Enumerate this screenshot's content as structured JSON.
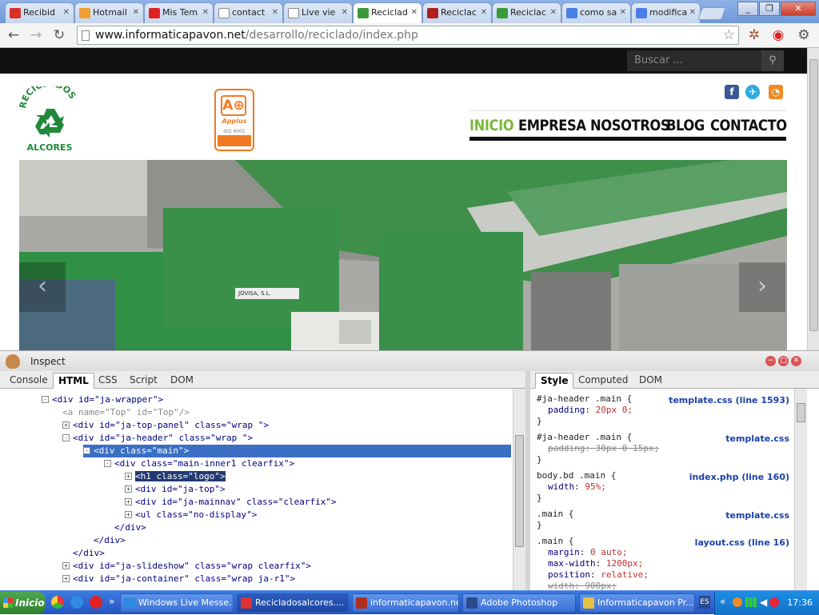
{
  "browser": {
    "tabs": [
      {
        "label": "Recibid",
        "icon": "gmail-icon",
        "color": "#d93025"
      },
      {
        "label": "Hotmail",
        "icon": "hotmail-icon",
        "color": "#f0a030"
      },
      {
        "label": "Mis Tem",
        "icon": "wix-icon",
        "color": "#e02020"
      },
      {
        "label": "contact",
        "icon": "page-icon",
        "color": "#ffffff"
      },
      {
        "label": "Live vie",
        "icon": "page-icon",
        "color": "#ffffff"
      },
      {
        "label": "Reciclad",
        "icon": "reciclados-icon",
        "color": "#3a9a3a"
      },
      {
        "label": "Reciclac",
        "icon": "joomla-icon",
        "color": "#b02020"
      },
      {
        "label": "Reciclac",
        "icon": "reciclados-icon",
        "color": "#3a9a3a"
      },
      {
        "label": "como sa",
        "icon": "google-icon",
        "color": "#4a7fe8"
      },
      {
        "label": "modifica",
        "icon": "google-icon",
        "color": "#4a7fe8"
      }
    ],
    "url_host": "www.informaticapavon.net",
    "url_path": "/desarrollo/reciclado/index.php"
  },
  "site": {
    "search_placeholder": "Buscar ...",
    "logo_text_top": "RECICLADOS",
    "logo_text_bottom": "ALCORES",
    "cert_brand": "Applus",
    "cert_iso": "ISO 9001",
    "nav": [
      "INICIO",
      "EMPRESA",
      "NOSOTROS",
      "BLOG",
      "CONTACTO"
    ],
    "machine_label": "JOVISA, S.L.",
    "colors": {
      "accent": "#7ab83a",
      "nav_text": "#111111",
      "topbar": "#111111"
    }
  },
  "firebug": {
    "title": "Inspect",
    "tabs": [
      "Console",
      "HTML",
      "CSS",
      "Script",
      "DOM"
    ],
    "side_tabs": [
      "Style",
      "Computed",
      "DOM"
    ],
    "html_lines": [
      {
        "indent": 4,
        "twisty": "−",
        "text": "<div id=\"ja-wrapper\">"
      },
      {
        "indent": 6,
        "twisty": "",
        "text": "<a name=\"Top\" id=\"Top\"/>"
      },
      {
        "indent": 6,
        "twisty": "+",
        "text": "<div id=\"ja-top-panel\" class=\"wrap \">"
      },
      {
        "indent": 6,
        "twisty": "−",
        "text": "<div id=\"ja-header\" class=\"wrap \">"
      },
      {
        "indent": 8,
        "twisty": "−",
        "text": "<div class=\"main\">",
        "selected": true
      },
      {
        "indent": 10,
        "twisty": "−",
        "text": "<div class=\"main-inner1 clearfix\">"
      },
      {
        "indent": 12,
        "twisty": "+",
        "text": "<h1 class=\"logo\">",
        "highlight": true
      },
      {
        "indent": 12,
        "twisty": "+",
        "text": "<div id=\"ja-top\">"
      },
      {
        "indent": 12,
        "twisty": "+",
        "text": "<div id=\"ja-mainnav\" class=\"clearfix\">"
      },
      {
        "indent": 12,
        "twisty": "+",
        "text": "<ul class=\"no-display\">"
      },
      {
        "indent": 11,
        "twisty": "",
        "text": "</div>"
      },
      {
        "indent": 9,
        "twisty": "",
        "text": "</div>"
      },
      {
        "indent": 7,
        "twisty": "",
        "text": "</div>"
      },
      {
        "indent": 6,
        "twisty": "+",
        "text": "<div id=\"ja-slideshow\" class=\"wrap clearfix\">"
      },
      {
        "indent": 6,
        "twisty": "+",
        "text": "<div id=\"ja-container\" class=\"wrap ja-r1\">"
      }
    ],
    "css_rules": [
      {
        "selector": "#ja-header .main {",
        "source": "template.css (line 1593)",
        "props": [
          {
            "name": "padding",
            "value": "20px 0;",
            "strike": false
          }
        ]
      },
      {
        "selector": "#ja-header .main {",
        "source": "template.css",
        "props": [
          {
            "name": "padding",
            "value": "30px 0 15px;",
            "strike": true
          }
        ]
      },
      {
        "selector": "body.bd .main {",
        "source": "index.php (line 160)",
        "props": [
          {
            "name": "width",
            "value": "95%;",
            "strike": false
          }
        ]
      },
      {
        "selector": ".main {",
        "source": "template.css",
        "props": []
      },
      {
        "selector": ".main {",
        "source": "layout.css (line 16)",
        "props": [
          {
            "name": "margin",
            "value": "0 auto;",
            "strike": false
          },
          {
            "name": "max-width",
            "value": "1200px;",
            "strike": false
          },
          {
            "name": "position",
            "value": "relative;",
            "strike": false
          },
          {
            "name": "width",
            "value": "900px;",
            "strike": true
          }
        ]
      }
    ]
  },
  "taskbar": {
    "start": "Inicio",
    "tasks": [
      {
        "label": "Windows Live Messe...",
        "color": "#2f8ae0"
      },
      {
        "label": "Recicladosalcores....",
        "color": "#dd3333",
        "active": true
      },
      {
        "label": "informaticapavon.ne...",
        "color": "#b03020"
      },
      {
        "label": "Adobe Photoshop",
        "color": "#2b4a8c"
      },
      {
        "label": "Informaticapavon Pr...",
        "color": "#e8c040"
      }
    ],
    "lang": "ES",
    "clock": "17:36"
  }
}
